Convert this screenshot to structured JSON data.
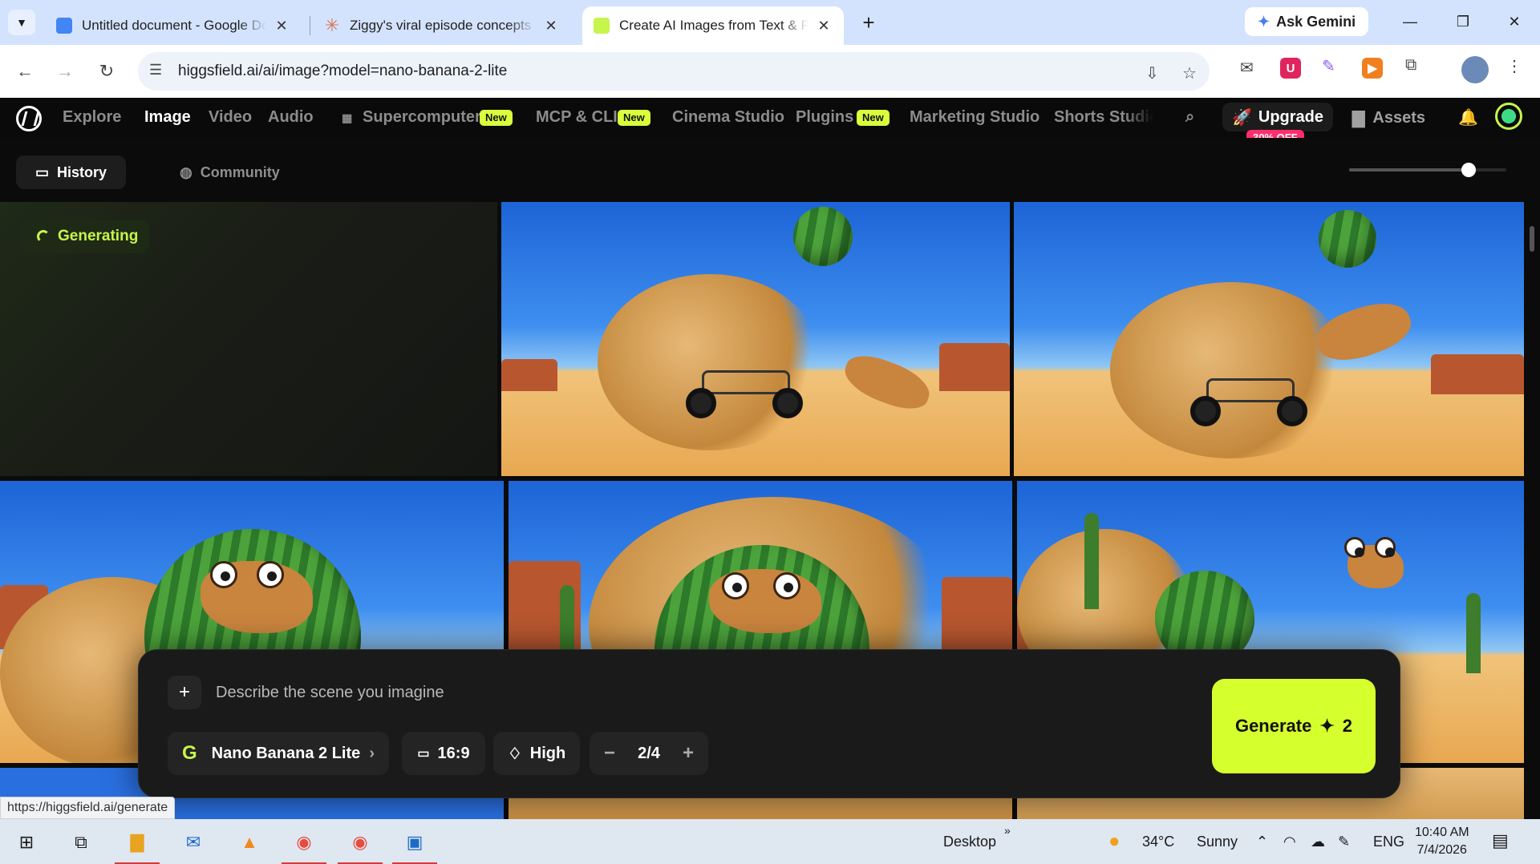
{
  "browser": {
    "tabs": [
      {
        "title": "Untitled document - Google Docs",
        "favicon": "docs-icon",
        "color": "#4285f4"
      },
      {
        "title": "Ziggy's viral episode concepts - Claude",
        "favicon": "claude-icon",
        "color": "#d97757"
      },
      {
        "title": "Create AI Images from Text & Photos",
        "favicon": "higgsfield-icon",
        "color": "#c6f54b"
      }
    ],
    "gemini_label": "Ask Gemini",
    "url": "higgsfield.ai/ai/image?model=nano-banana-2-lite",
    "status_url": "https://higgsfield.ai/generate"
  },
  "appnav": {
    "items": [
      "Explore",
      "Image",
      "Video",
      "Audio",
      "Supercomputer",
      "MCP & CLI",
      "Cinema Studio",
      "Plugins",
      "Marketing Studio",
      "Shorts Studio"
    ],
    "badge": "New",
    "upgrade": "Upgrade",
    "discount": "30% OFF",
    "assets": "Assets"
  },
  "subnav": {
    "history": "History",
    "community": "Community",
    "zoom_level": 0.76
  },
  "gallery": {
    "generating_label": "Generating"
  },
  "prompt": {
    "placeholder": "Describe the scene you imagine",
    "model": "Nano Banana 2 Lite",
    "aspect": "16:9",
    "quality": "High",
    "count": "2/4",
    "generate": "Generate",
    "cost": "2"
  },
  "taskbar": {
    "desktop": "Desktop",
    "weather": "34°C",
    "condition": "Sunny",
    "lang": "ENG",
    "time": "10:40 AM",
    "date": "7/4/2026"
  },
  "colors": {
    "accent": "#d6ff2e",
    "badge": "#d9ff3c",
    "discount": "#ff2f6e"
  }
}
